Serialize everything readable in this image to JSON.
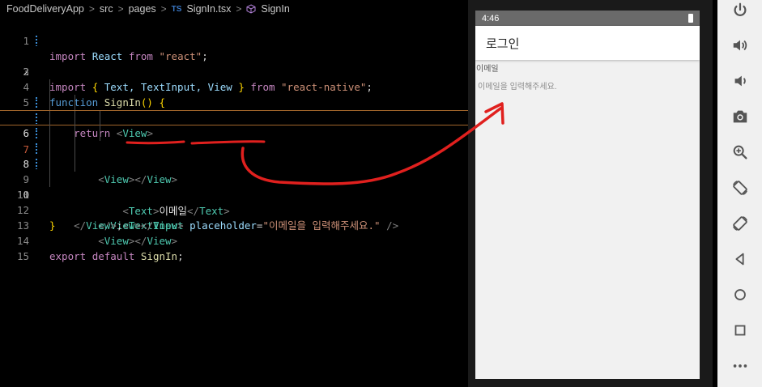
{
  "breadcrumb": {
    "project": "FoodDeliveryApp",
    "folder1": "src",
    "folder2": "pages",
    "ts_badge": "TS",
    "file": "SignIn.tsx",
    "symbol": "SignIn"
  },
  "code": {
    "line_numbers": [
      "1",
      "2",
      "3",
      "4",
      "5",
      "6",
      "7",
      "8",
      "9",
      "10",
      "11",
      "12",
      "13",
      "14",
      "15"
    ],
    "l1": {
      "import": "import",
      "id": "React",
      "from": "from",
      "str": "\"react\"",
      "semi": ";"
    },
    "l2": {
      "import": "import",
      "open": "{",
      "ids": "Text, TextInput, View",
      "close": "}",
      "from": "from",
      "str": "\"react-native\"",
      "semi": ";"
    },
    "l4": {
      "function": "function",
      "name": "SignIn",
      "parens": "()",
      "brace": "{"
    },
    "l5": {
      "return": "return",
      "tag": "View"
    },
    "l6": {
      "open": "View",
      "close": "View"
    },
    "l7": {
      "open": "Text",
      "text": "이메일",
      "close": "Text"
    },
    "l8": {
      "tag": "TextInput",
      "attr": "placeholder",
      "eq": "=",
      "val": "\"이메일을 입력해주세요.\"",
      "selfclose": "/>"
    },
    "l9": {
      "open": "View",
      "close": "View"
    },
    "l10": {
      "open": "View",
      "close": "View"
    },
    "l11": {
      "close": "View",
      "semi": ";"
    },
    "l12": {
      "brace": "}"
    },
    "l14": {
      "export": "export",
      "default": "default",
      "id": "SignIn",
      "semi": ";"
    }
  },
  "phone": {
    "time": "4:46",
    "title": "로그인",
    "label": "이메일",
    "placeholder": "이메일을 입력해주세요."
  },
  "toolbar": {
    "buttons": [
      "power-icon",
      "volume-up-icon",
      "volume-down-icon",
      "camera-icon",
      "zoom-icon",
      "rotate-left-icon",
      "rotate-right-icon",
      "back-icon",
      "home-icon",
      "overview-icon",
      "more-icon"
    ]
  },
  "colors": {
    "annotation": "#e0201e",
    "highlight_border": "#a0652b"
  }
}
